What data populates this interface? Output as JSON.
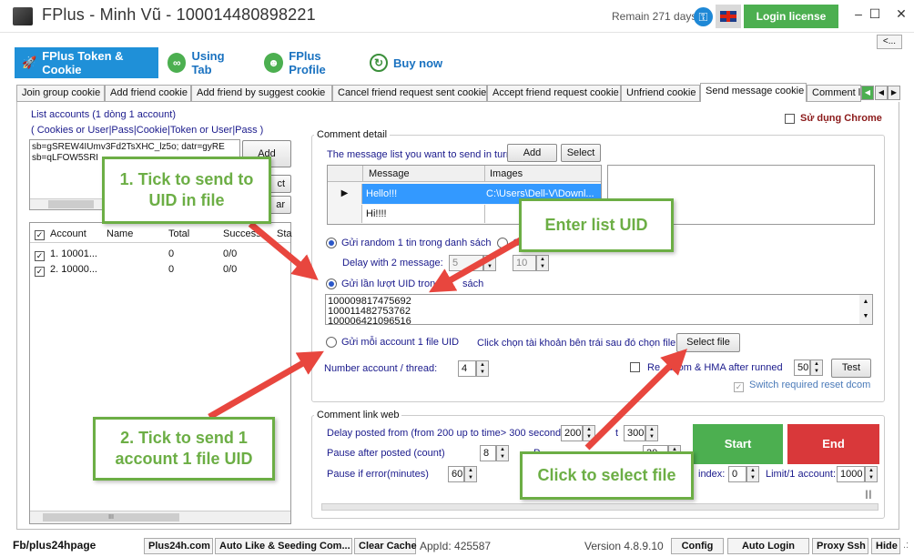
{
  "window": {
    "title": "FPlus - Minh Vũ - 100014480898221",
    "remain": "Remain 271 days",
    "login_license": "Login license",
    "minimize": "–",
    "maximize": "☐",
    "close": "✕",
    "collapse": "<..."
  },
  "main_tabs": [
    {
      "label": "FPlus Token & Cookie"
    },
    {
      "label": "Using Tab"
    },
    {
      "label": "FPlus Profile"
    },
    {
      "label": "Buy now"
    }
  ],
  "sub_tabs": [
    "Join group cookie",
    "Add friend cookie",
    "Add friend by suggest cookie",
    "Cancel friend request sent cookie",
    "Accept friend request cookie",
    "Unfriend cookie",
    "Send message cookie",
    "Comment lik"
  ],
  "left": {
    "list_title": "List accounts (1 dòng 1 account)",
    "list_hint": "( Cookies or User|Pass|Cookie|Token or User|Pass )",
    "accounts_text": [
      "sb=gSREW4IUmv3Fd2TsXHC_lz5o; datr=gyRE",
      "sb=qLFOW5SRI"
    ],
    "add_button": "Add",
    "btn2_label": "ct",
    "btn3_label": "ar",
    "columns": [
      "Account",
      "Name",
      "Total",
      "Success",
      "Sta"
    ],
    "rows": [
      {
        "account": "1. 10001...",
        "name": "",
        "total": "0",
        "success": "0/0"
      },
      {
        "account": "2. 10000...",
        "name": "",
        "total": "0",
        "success": "0/0"
      }
    ],
    "hscroll_mark": "III"
  },
  "chrome_option": "Sử dụng Chrome",
  "comment_detail": {
    "title": "Comment detail",
    "msg_list_label": "The message list you want to send in turn",
    "add_button": "Add",
    "select_button": "Select",
    "columns": [
      "Message",
      "Images"
    ],
    "rows": [
      {
        "message": "Hello!!!",
        "images": "C:\\Users\\Dell-V\\Downl..."
      },
      {
        "message": "Hi!!!!",
        "images": ""
      }
    ],
    "random_label": "Gửi random 1 tin trong danh sách",
    "option2_label": "G",
    "delay_label": "Delay with 2 message:",
    "delay_from": "5",
    "delay_to": "10",
    "uid_list_label": "Gửi lần lượt UID trong",
    "uid_list_label2": "sách",
    "uids": [
      "100009817475692",
      "100011482753762",
      "100006421096516"
    ],
    "per_file_label": "Gửi mỗi account 1 file UID",
    "select_hint": "Click chọn tài khoản bên trái sau đó chọn file",
    "select_file_button": "Select file",
    "thread_label": "Number account / thread:",
    "thread_value": "4",
    "reset_label_a": "Re",
    "reset_label_b": "dcom & HMA after runned",
    "reset_value": "50",
    "test_button": "Test",
    "switch_label": "Switch required reset dcom"
  },
  "comment_link": {
    "title": "Comment link web",
    "delay_label": "Delay posted from (from 200 up to time> 300 seconds)",
    "delay_from": "200",
    "delay_to_label": "t",
    "delay_to": "300",
    "pause_after_label": "Pause after posted (count)",
    "pause_after": "8",
    "pause_after_tail": "P",
    "pause_after_tail_value": "30",
    "pause_error_label": "Pause if error(minutes)",
    "pause_error": "60",
    "index_label": "index:",
    "index_value": "0",
    "limit_label": "Limit/1 account:",
    "limit_value": "1000",
    "pause_icon": "II",
    "start_button": "Start",
    "end_button": "End"
  },
  "callouts": {
    "c1": "1. Tick to send to UID in file",
    "c2": "Enter list UID",
    "c3": "2. Tick to send 1 account 1 file UID",
    "c4": "Click to select file"
  },
  "bottom": {
    "fb_link": "Fb/plus24hpage",
    "buttons": [
      "Plus24h.com",
      "Auto Like & Seeding Com...",
      "Clear Cache"
    ],
    "app_id": "AppId: 425587",
    "version": "Version 4.8.9.10",
    "right_buttons": [
      "Config",
      "Auto Login",
      "Proxy Ssh",
      "Hide"
    ],
    "resize_grip": ".:"
  },
  "colors": {
    "accent": "#1f90d8",
    "green": "#4caf50",
    "red": "#d9383a",
    "callout": "#6cae45",
    "arrow": "#e8463e"
  }
}
